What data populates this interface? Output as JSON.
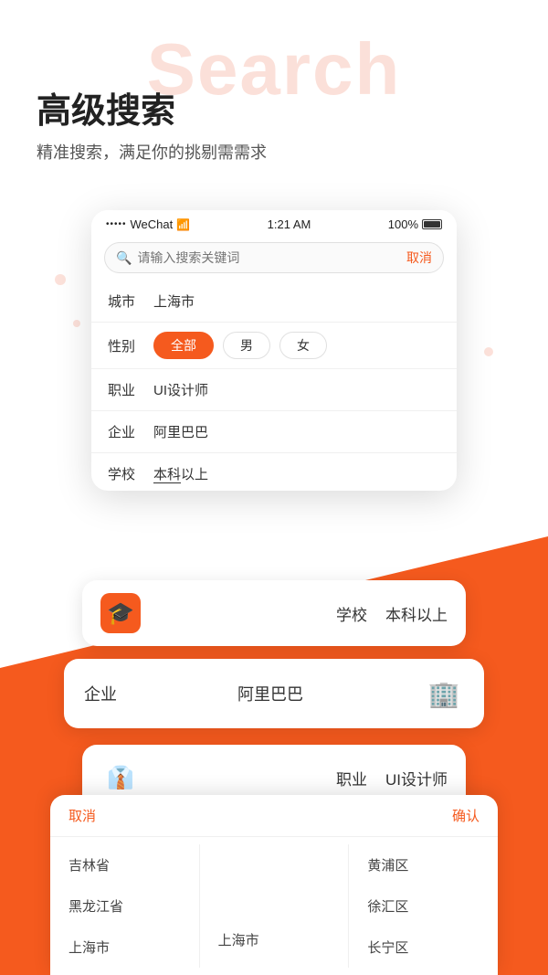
{
  "page": {
    "bg_text": "Search",
    "title": "高级搜索",
    "subtitle": "精准搜索，满足你的挑剔需需求"
  },
  "status_bar": {
    "dots": "•••••",
    "app": "WeChat",
    "wifi": "WiFi",
    "time": "1:21 AM",
    "battery": "100%"
  },
  "search": {
    "placeholder": "请输入搜索关键词",
    "cancel_label": "取消"
  },
  "filters": {
    "city_label": "城市",
    "city_value": "上海市",
    "gender_label": "性别",
    "gender_options": [
      "全部",
      "男",
      "女"
    ],
    "gender_active": "全部",
    "job_label": "职业",
    "job_value": "UI设计师",
    "company_label": "企业",
    "company_value": "阿里巴巴",
    "school_label": "学校",
    "school_value": "本科以上"
  },
  "overlay_school": {
    "label": "学校",
    "value": "本科以上"
  },
  "overlay_company": {
    "label": "企业",
    "value": "阿里巴巴"
  },
  "overlay_job": {
    "label": "职业",
    "value": "UI设计师"
  },
  "location_panel": {
    "cancel_label": "取消",
    "confirm_label": "确认",
    "col1": [
      "吉林省",
      "黑龙江省",
      "上海市"
    ],
    "col2": [
      "",
      "",
      "上海市"
    ],
    "col3": [
      "黄浦区",
      "徐汇区",
      "长宁区"
    ]
  }
}
